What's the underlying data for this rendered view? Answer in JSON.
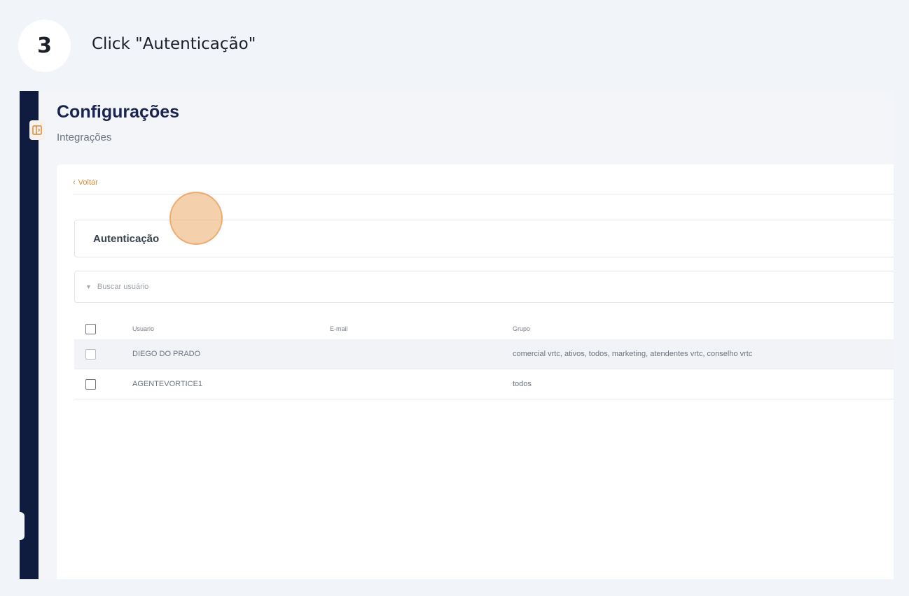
{
  "step": {
    "number": "3",
    "instruction": "Click \"Autenticação\""
  },
  "colors": {
    "background": "#f1f4f9",
    "sidebar": "#0f1b3f",
    "title": "#1a2453",
    "accent": "#d98a3c",
    "highlight_marker": "#edaa69"
  },
  "header": {
    "title": "Configurações",
    "subtitle": "Integrações"
  },
  "card": {
    "back_label": "Voltar",
    "back_icon": "chevron-left-icon",
    "section_label": "Autenticação",
    "search": {
      "icon": "filter-icon",
      "placeholder": "Buscar usuário"
    }
  },
  "table": {
    "columns": [
      "Usuario",
      "E-mail",
      "Grupo"
    ],
    "rows": [
      {
        "user": "DIEGO DO PRADO",
        "email": "",
        "group": "comercial vrtc, ativos, todos, marketing, atendentes vrtc, conselho vrtc"
      },
      {
        "user": "AGENTEVORTICE1",
        "email": "",
        "group": "todos"
      }
    ]
  }
}
